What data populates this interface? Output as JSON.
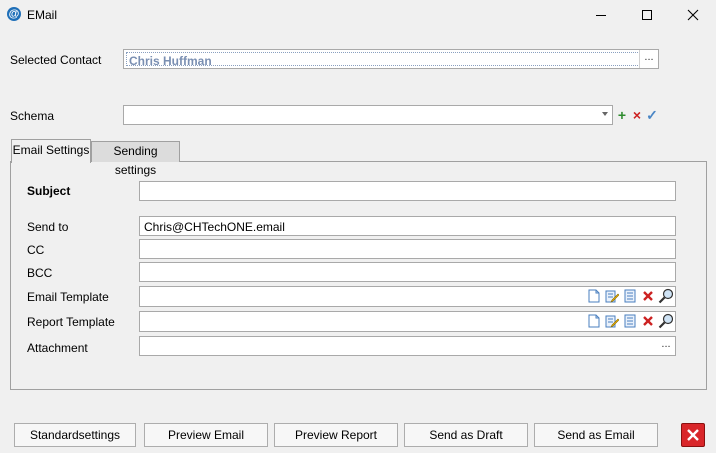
{
  "window": {
    "title": "EMail",
    "icon": "at-sign-icon",
    "controls": [
      "minimize-icon",
      "maximize-icon",
      "close-icon"
    ]
  },
  "contact": {
    "label": "Selected Contact",
    "value": "Chris Huffman",
    "picker": "..."
  },
  "schema": {
    "label": "Schema",
    "value": "",
    "add": "+",
    "remove": "×",
    "confirm": "✓"
  },
  "tabs": [
    {
      "label": "Email Settings",
      "active": true
    },
    {
      "label": "Sending settings",
      "active": false
    }
  ],
  "form": {
    "subject_label": "Subject",
    "subject_value": "",
    "send_to_label": "Send to",
    "send_to_value": "Chris@CHTechONE.email",
    "cc_label": "CC",
    "cc_value": "",
    "bcc_label": "BCC",
    "bcc_value": "",
    "email_template_label": "Email Template",
    "report_template_label": "Report Template",
    "attachment_label": "Attachment",
    "attachment_picker": "..."
  },
  "buttons": {
    "standard": "Standardsettings",
    "preview_email": "Preview Email",
    "preview_report": "Preview Report",
    "send_draft": "Send as Draft",
    "send_email": "Send as Email"
  },
  "colors": {
    "accent": "#1f6fb8",
    "close_button": "#d9262a",
    "contact_text": "#7a8fb2",
    "add_green": "#2e8b2e",
    "delete_red": "#cc2222"
  }
}
